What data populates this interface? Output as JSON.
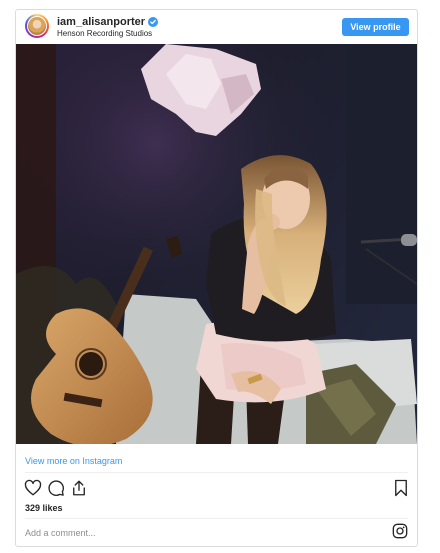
{
  "post": {
    "username": "iam_alisanporter",
    "location": "Henson Recording Studios",
    "view_profile_label": "View profile",
    "view_more_label": "View more on Instagram",
    "likes": "329 likes",
    "comment_placeholder": "Add a comment..."
  },
  "icons": {
    "verified": "verified-badge-icon",
    "like": "heart-icon",
    "comment": "comment-icon",
    "share": "share-icon",
    "save": "bookmark-icon",
    "instagram": "instagram-icon"
  },
  "colors": {
    "accent": "#3897f0",
    "text": "#262626",
    "muted": "#8e8e8e",
    "border": "#dbdbdb"
  }
}
